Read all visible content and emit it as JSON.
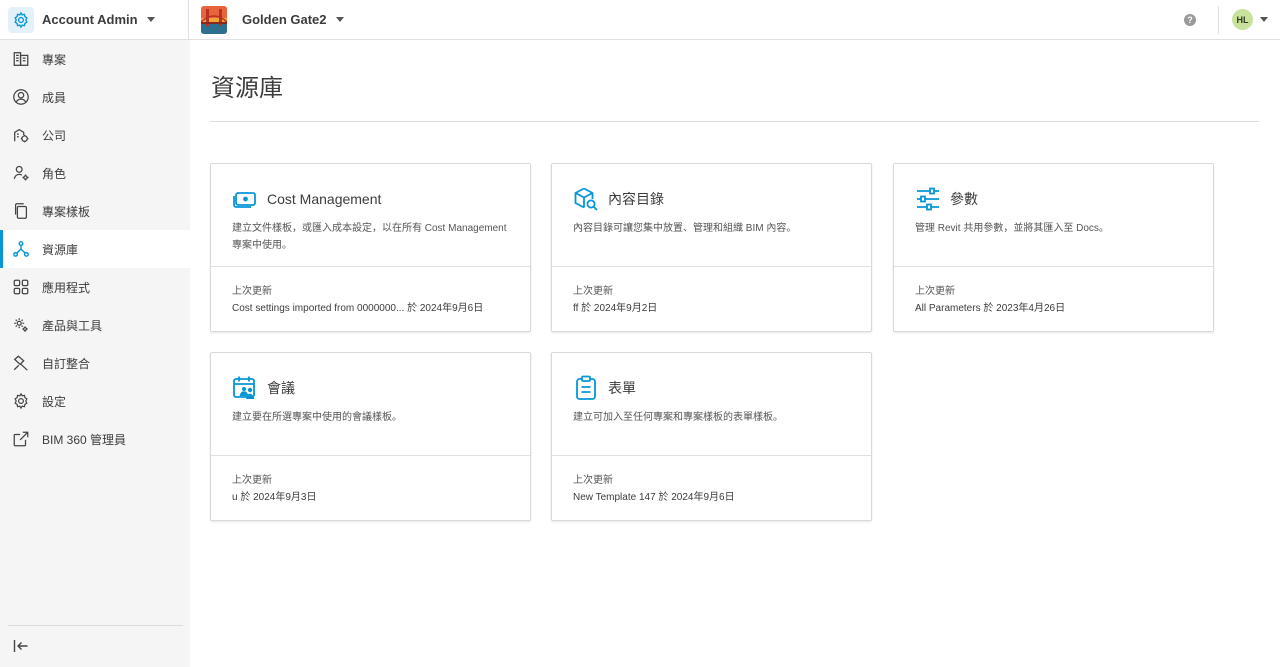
{
  "topbar": {
    "app_name": "Account Admin",
    "app_icon": "gear-icon",
    "project_name": "Golden Gate2",
    "help_label": "?",
    "user_initials": "HL"
  },
  "sidebar": {
    "items": [
      {
        "label": "專案",
        "icon": "building-icon"
      },
      {
        "label": "成員",
        "icon": "user-circle-icon"
      },
      {
        "label": "公司",
        "icon": "company-icon"
      },
      {
        "label": "角色",
        "icon": "user-gear-icon"
      },
      {
        "label": "專案樣板",
        "icon": "copy-icon"
      },
      {
        "label": "資源庫",
        "icon": "network-icon",
        "active": true
      },
      {
        "label": "應用程式",
        "icon": "apps-grid-icon"
      },
      {
        "label": "產品與工具",
        "icon": "gears-icon"
      },
      {
        "label": "自訂整合",
        "icon": "hammer-icon"
      },
      {
        "label": "設定",
        "icon": "settings-icon"
      },
      {
        "label": "BIM 360 管理員",
        "icon": "external-link-icon"
      }
    ],
    "collapse_icon": "collapse-left-icon"
  },
  "main": {
    "title": "資源庫",
    "cards": [
      {
        "title": "Cost Management",
        "icon": "cost-icon",
        "description": "建立文件樣板，或匯入成本設定，以在所有 Cost Management 專案中使用。",
        "meta_label": "上次更新",
        "meta_value": "Cost settings imported from 0000000...  於 2024年9月6日"
      },
      {
        "title": "內容目錄",
        "icon": "catalog-cube-icon",
        "description": "內容目錄可讓您集中放置、管理和組織 BIM 內容。",
        "meta_label": "上次更新",
        "meta_value": "ff 於 2024年9月2日"
      },
      {
        "title": "參數",
        "icon": "sliders-icon",
        "description": "管理 Revit 共用參數，並將其匯入至 Docs。",
        "meta_label": "上次更新",
        "meta_value": "All Parameters 於 2023年4月26日"
      },
      {
        "title": "會議",
        "icon": "meeting-calendar-icon",
        "description": "建立要在所選專案中使用的會議樣板。",
        "meta_label": "上次更新",
        "meta_value": "u 於 2024年9月3日"
      },
      {
        "title": "表單",
        "icon": "clipboard-icon",
        "description": "建立可加入至任何專案和專案樣板的表單樣板。",
        "meta_label": "上次更新",
        "meta_value": "New Template 147 於 2024年9月6日"
      }
    ]
  },
  "colors": {
    "accent": "#0696d7",
    "sidebar_bg": "#f5f5f5",
    "avatar_bg": "#c8e29e"
  }
}
